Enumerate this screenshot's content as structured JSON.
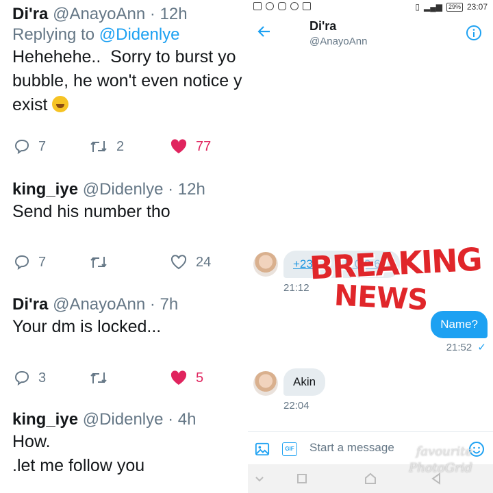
{
  "tweets": [
    {
      "name": "Di'ra",
      "handle": "@AnayoAnn · 12h",
      "reply_prefix": "Replying to ",
      "reply_to": "@Didenlye",
      "body": "Hehehehe..  Sorry to burst yo\nbubble, he won't even notice y\nexist",
      "replies": "7",
      "retweets": "2",
      "likes": "77",
      "liked": true
    },
    {
      "name": "king_iye",
      "handle": "@Didenlye · 12h",
      "body": "Send his number tho",
      "replies": "7",
      "retweets": "",
      "likes": "24",
      "liked": false
    },
    {
      "name": "Di'ra",
      "handle": "@AnayoAnn · 7h",
      "body": "Your dm is locked...",
      "replies": "3",
      "retweets": "",
      "likes": "5",
      "liked": true
    },
    {
      "name": "king_iye",
      "handle": "@Didenlye · 4h",
      "body": "How.\n.let me follow you"
    }
  ],
  "status_bar": {
    "time": "23:07",
    "battery": "29%"
  },
  "dm": {
    "name": "Di'ra",
    "handle": "@AnayoAnn",
    "messages": [
      {
        "direction": "in",
        "text": "+23",
        "hidden_text": "5 0 0 6",
        "time": "21:12"
      },
      {
        "direction": "out",
        "text": "Name?",
        "time": "21:52",
        "read_mark": "✓"
      },
      {
        "direction": "in",
        "text": "Akin",
        "time": "22:04"
      }
    ],
    "composer_placeholder": "Start a message",
    "gif_label": "GIF"
  },
  "overlay": {
    "line1": "BREAKING",
    "line2": "NEWS"
  },
  "watermark": {
    "line1": "favourite",
    "line2": "PhotoGrid"
  },
  "colors": {
    "accent": "#1da1f2",
    "like": "#e0245e",
    "muted": "#657786",
    "breaking": "#e0262a"
  }
}
